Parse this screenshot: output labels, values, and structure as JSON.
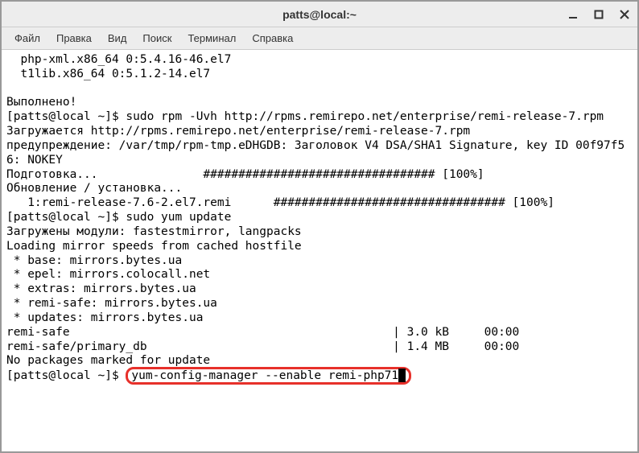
{
  "window": {
    "title": "patts@local:~"
  },
  "menubar": {
    "items": [
      "Файл",
      "Правка",
      "Вид",
      "Поиск",
      "Терминал",
      "Справка"
    ]
  },
  "terminal": {
    "lines": [
      "  php-xml.x86_64 0:5.4.16-46.el7",
      "  t1lib.x86_64 0:5.1.2-14.el7",
      "",
      "Выполнено!",
      "[patts@local ~]$ sudo rpm -Uvh http://rpms.remirepo.net/enterprise/remi-release-7.rpm",
      "Загружается http://rpms.remirepo.net/enterprise/remi-release-7.rpm",
      "предупреждение: /var/tmp/rpm-tmp.eDHGDB: Заголовок V4 DSA/SHA1 Signature, key ID 00f97f56: NOKEY",
      "Подготовка...               ################################# [100%]",
      "Обновление / установка...",
      "   1:remi-release-7.6-2.el7.remi      ################################# [100%]",
      "[patts@local ~]$ sudo yum update",
      "Загружены модули: fastestmirror, langpacks",
      "Loading mirror speeds from cached hostfile",
      " * base: mirrors.bytes.ua",
      " * epel: mirrors.colocall.net",
      " * extras: mirrors.bytes.ua",
      " * remi-safe: mirrors.bytes.ua",
      " * updates: mirrors.bytes.ua",
      "remi-safe                                              | 3.0 kB     00:00",
      "remi-safe/primary_db                                   | 1.4 MB     00:00",
      "No packages marked for update"
    ],
    "prompt_prefix": "[patts@local ~]$ ",
    "highlighted_command": "yum-config-manager --enable remi-php71"
  }
}
